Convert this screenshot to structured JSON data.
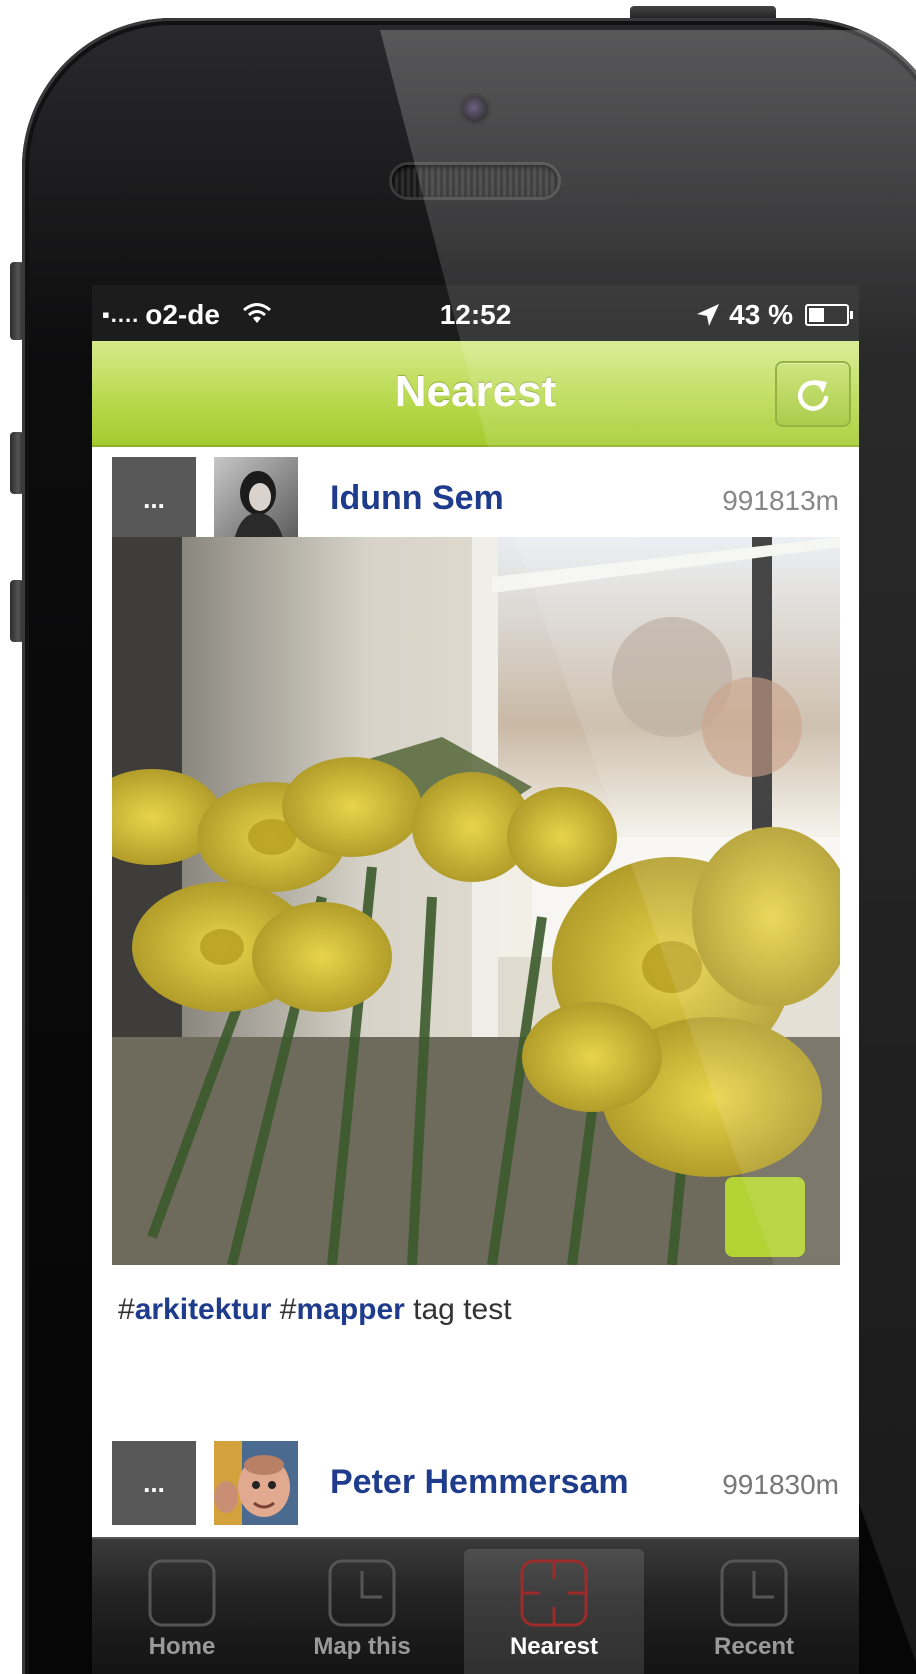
{
  "status_bar": {
    "signal": "▪....",
    "carrier": "o2-de",
    "time": "12:52",
    "battery": "43 %",
    "battery_level": 0.43
  },
  "nav": {
    "title": "Nearest",
    "refresh_icon": "refresh-icon"
  },
  "posts": [
    {
      "more_label": "...",
      "username": "Idunn Sem",
      "distance": "991813m",
      "caption": {
        "hash1": "#",
        "tag1": "arkitektur",
        "hash2": " #",
        "tag2": "mapper",
        "text": " tag test"
      }
    },
    {
      "more_label": "...",
      "username": "Peter Hemmersam",
      "distance": "991830m"
    }
  ],
  "tabs": [
    {
      "label": "Home",
      "icon": "home-icon",
      "active": false
    },
    {
      "label": "Map this",
      "icon": "clock-icon",
      "active": false
    },
    {
      "label": "Nearest",
      "icon": "target-icon",
      "active": true
    },
    {
      "label": "Recent",
      "icon": "clock-icon",
      "active": false
    }
  ],
  "colors": {
    "nav_green": "#b9da4f",
    "username_blue": "#1f3c8c",
    "map_badge": "#b3d234"
  }
}
